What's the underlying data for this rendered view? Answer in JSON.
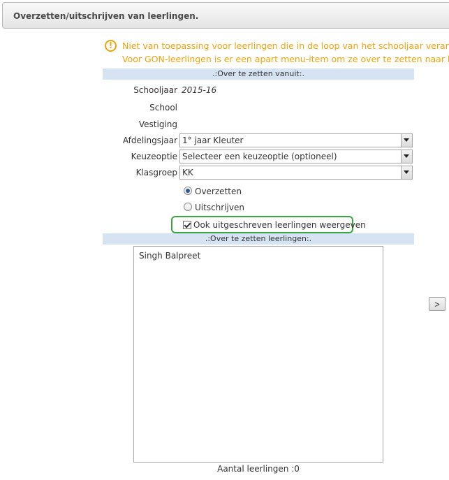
{
  "header": {
    "title": "Overzetten/uitschrijven van leerlingen."
  },
  "warning": {
    "icon": "warning-icon",
    "color": "#f0a30a",
    "line1": "Niet van toepassing voor leerlingen die in de loop van het schooljaar veranderen",
    "line2": "Voor GON-leerlingen is er een apart menu-item om ze over te zetten naar het v"
  },
  "from_section": {
    "header": ".:Over te zetten vanuit:.",
    "fields": {
      "schooljaar_label": "Schooljaar",
      "schooljaar_value": "2015-16",
      "school_label": "School",
      "vestiging_label": "Vestiging",
      "afdelingsjaar_label": "Afdelingsjaar",
      "afdelingsjaar_value": "1° jaar Kleuter",
      "keuzeoptie_label": "Keuzeoptie",
      "keuzeoptie_value": "Selecteer een keuzeoptie (optioneel)",
      "klasgroep_label": "Klasgroep",
      "klasgroep_value": "KK"
    },
    "action": {
      "overzetten_label": "Overzetten",
      "uitschrijven_label": "Uitschrijven",
      "selected": "Overzetten"
    },
    "show_unsubscribed": {
      "label": "Ook uitgeschreven leerlingen weergeven",
      "checked": true
    }
  },
  "students_section": {
    "header": ".:Over te zetten leerlingen:.",
    "items": [
      "Singh Balpreet"
    ],
    "count_label": "Aantal leerlingen :0"
  },
  "move_button": {
    "label": ">"
  },
  "colors": {
    "section_header_bg": "#d5e3f3",
    "highlight_border": "#3aa541",
    "warning": "#f0a30a"
  }
}
